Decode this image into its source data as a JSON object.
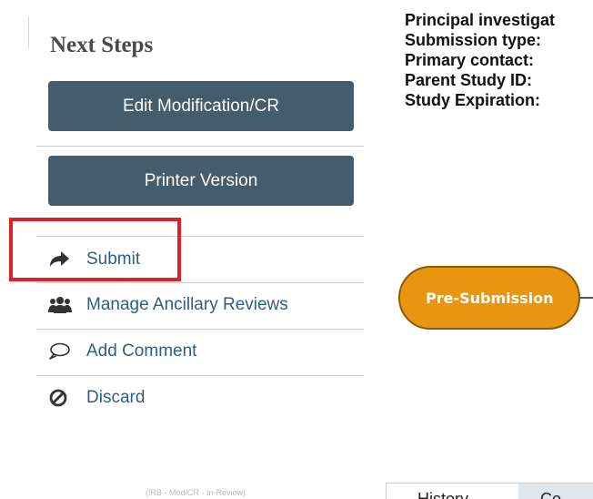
{
  "sidebar": {
    "title": "Next Steps",
    "buttons": [
      {
        "label": "Edit Modification/CR"
      },
      {
        "label": "Printer Version"
      }
    ],
    "actions": [
      {
        "label": "Submit",
        "icon": "share-arrow-icon"
      },
      {
        "label": "Manage Ancillary Reviews",
        "icon": "users-group-icon"
      },
      {
        "label": "Add Comment",
        "icon": "speech-bubble-icon"
      },
      {
        "label": "Discard",
        "icon": "prohibited-icon"
      }
    ],
    "footer_note": "(IRB - Mod/CR - In-Review)"
  },
  "info": {
    "labels": [
      "Principal investigat",
      "Submission type:",
      "Primary contact:",
      "Parent Study ID:",
      "Study Expiration:"
    ]
  },
  "workflow": {
    "current_state": "Pre-Submission"
  },
  "tabs": {
    "history": "History",
    "other": "Co"
  },
  "colors": {
    "button_bg": "#445c6c",
    "link": "#2f5d8a",
    "highlight": "#e02028",
    "state_node": "#e8950f"
  }
}
